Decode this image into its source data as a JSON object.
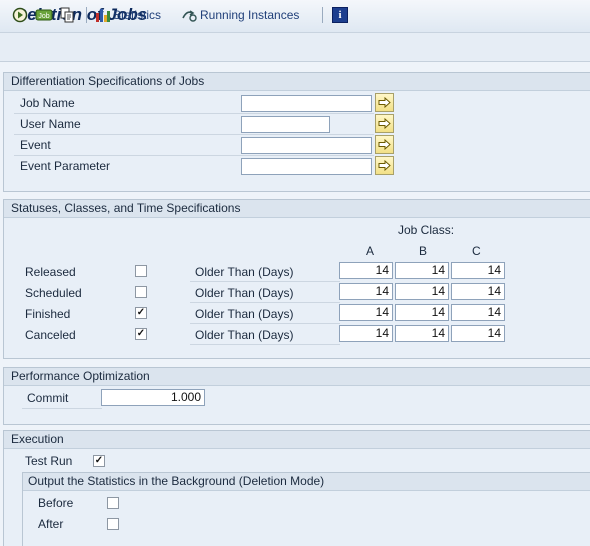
{
  "window": {
    "title": "Deletion of Jobs"
  },
  "toolbar": {
    "execute_icon": "execute-icon",
    "job_icon_label": "Job",
    "variant_icon": "get-variant-icon",
    "statistics": "Statistics",
    "running_instances": "Running Instances",
    "info_icon_label": "i"
  },
  "diff": {
    "title": "Differentiation Specifications of Jobs",
    "fields": [
      {
        "label": "Job Name",
        "value": "",
        "multi": true
      },
      {
        "label": "User Name",
        "value": "",
        "multi": true
      },
      {
        "label": "Event",
        "value": "",
        "multi": true
      },
      {
        "label": "Event Parameter",
        "value": "",
        "multi": true
      }
    ]
  },
  "statuses": {
    "title": "Statuses, Classes, and Time Specifications",
    "job_class_label": "Job Class:",
    "class_headers": [
      "A",
      "B",
      "C"
    ],
    "rows": [
      {
        "label": "Released",
        "checked": false,
        "older": "Older Than (Days)",
        "values": [
          "14",
          "14",
          "14"
        ]
      },
      {
        "label": "Scheduled",
        "checked": false,
        "older": "Older Than (Days)",
        "values": [
          "14",
          "14",
          "14"
        ]
      },
      {
        "label": "Finished",
        "checked": true,
        "older": "Older Than (Days)",
        "values": [
          "14",
          "14",
          "14"
        ]
      },
      {
        "label": "Canceled",
        "checked": true,
        "older": "Older Than (Days)",
        "values": [
          "14",
          "14",
          "14"
        ]
      }
    ]
  },
  "performance": {
    "title": "Performance Optimization",
    "commit_label": "Commit",
    "commit_value": "1.000"
  },
  "execution": {
    "title": "Execution",
    "test_run_label": "Test Run",
    "test_run_checked": true,
    "output": {
      "title": "Output the Statistics in the Background (Deletion Mode)",
      "before_label": "Before",
      "before_checked": false,
      "after_label": "After",
      "after_checked": false
    }
  },
  "colors": {
    "title": "#0d2a5c",
    "accent_link": "#21407a",
    "f4_button": "#f2e086"
  }
}
